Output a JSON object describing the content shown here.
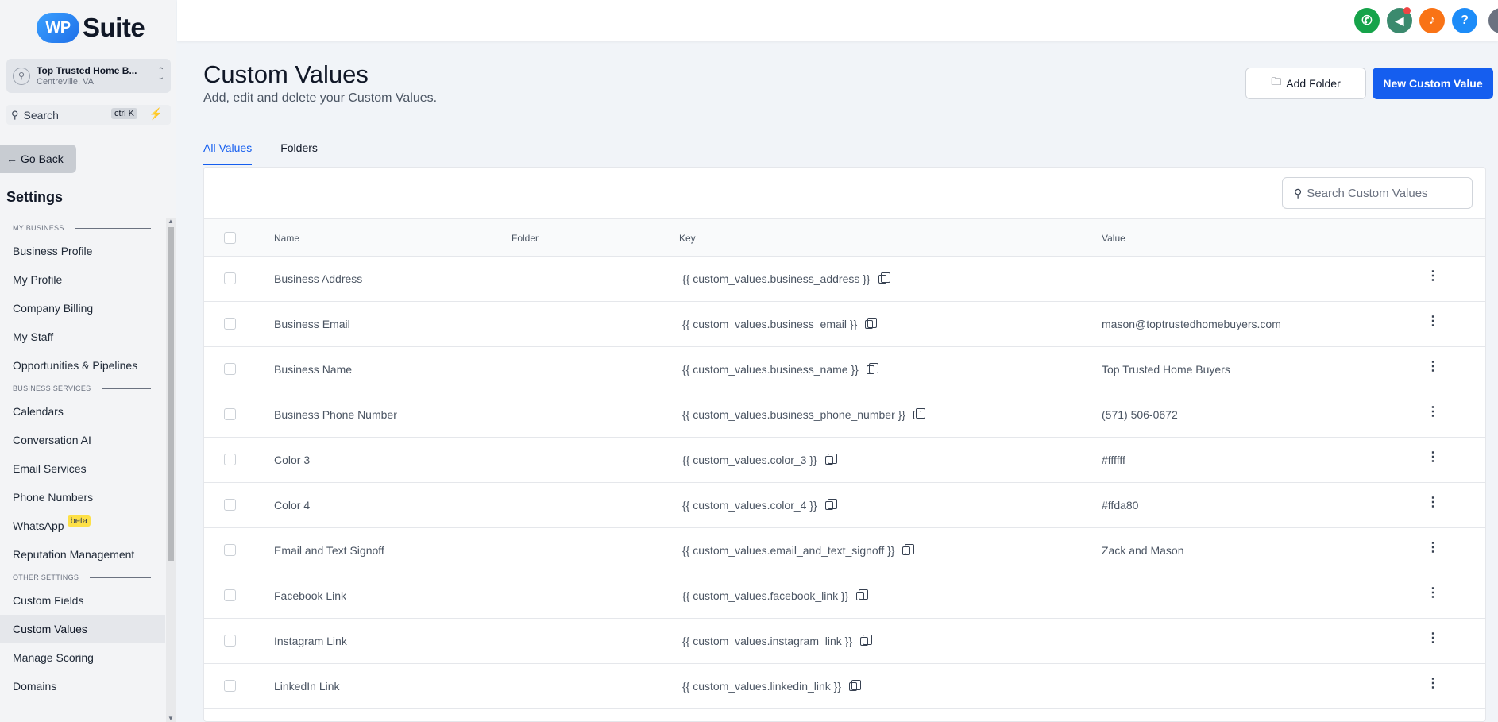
{
  "sidebar": {
    "logo": {
      "badge": "WP",
      "text": "Suite"
    },
    "account": {
      "name": "Top Trusted Home B...",
      "location": "Centreville, VA"
    },
    "search": {
      "label": "Search",
      "shortcut": "ctrl K"
    },
    "go_back": "Go Back",
    "settings_title": "Settings",
    "sections": [
      {
        "title": "MY BUSINESS",
        "items": [
          "Business Profile",
          "My Profile",
          "Company Billing",
          "My Staff",
          "Opportunities & Pipelines"
        ]
      },
      {
        "title": "BUSINESS SERVICES",
        "items": [
          "Calendars",
          "Conversation AI",
          "Email Services",
          "Phone Numbers",
          "WhatsApp",
          "Reputation Management"
        ]
      },
      {
        "title": "OTHER SETTINGS",
        "items": [
          "Custom Fields",
          "Custom Values",
          "Manage Scoring",
          "Domains"
        ]
      }
    ],
    "beta_label": "beta",
    "active_item": "Custom Values"
  },
  "topbar": {
    "icons": [
      {
        "name": "phone-icon",
        "color": "#16a34a",
        "glyph": "✆"
      },
      {
        "name": "megaphone-icon",
        "color": "#3b8a6e",
        "glyph": "📢"
      },
      {
        "name": "bell-icon",
        "color": "#f97316",
        "glyph": "🔔"
      },
      {
        "name": "help-icon",
        "color": "#1d8cf8",
        "glyph": "?"
      }
    ]
  },
  "page": {
    "title": "Custom Values",
    "subtitle": "Add, edit and delete your Custom Values.",
    "add_folder": "Add Folder",
    "new_value": "New Custom Value",
    "tabs": [
      "All Values",
      "Folders"
    ],
    "search_placeholder": "Search Custom Values"
  },
  "table": {
    "headers": {
      "name": "Name",
      "folder": "Folder",
      "key": "Key",
      "value": "Value"
    },
    "rows": [
      {
        "name": "Business Address",
        "folder": "",
        "key": "{{ custom_values.business_address }}",
        "value": ""
      },
      {
        "name": "Business Email",
        "folder": "",
        "key": "{{ custom_values.business_email }}",
        "value": "mason@toptrustedhomebuyers.com"
      },
      {
        "name": "Business Name",
        "folder": "",
        "key": "{{ custom_values.business_name }}",
        "value": "Top Trusted Home Buyers"
      },
      {
        "name": "Business Phone Number",
        "folder": "",
        "key": "{{ custom_values.business_phone_number }}",
        "value": "(571) 506-0672"
      },
      {
        "name": "Color 3",
        "folder": "",
        "key": "{{ custom_values.color_3 }}",
        "value": "#ffffff"
      },
      {
        "name": "Color 4",
        "folder": "",
        "key": "{{ custom_values.color_4 }}",
        "value": "#ffda80"
      },
      {
        "name": "Email and Text Signoff",
        "folder": "",
        "key": "{{ custom_values.email_and_text_signoff }}",
        "value": "Zack and Mason"
      },
      {
        "name": "Facebook Link",
        "folder": "",
        "key": "{{ custom_values.facebook_link }}",
        "value": ""
      },
      {
        "name": "Instagram Link",
        "folder": "",
        "key": "{{ custom_values.instagram_link }}",
        "value": ""
      },
      {
        "name": "LinkedIn Link",
        "folder": "",
        "key": "{{ custom_values.linkedin_link }}",
        "value": ""
      }
    ]
  },
  "colors": {
    "accent": "#155eef",
    "sidebar_bg": "#f3f4f6",
    "page_bg": "#f1f4f8"
  }
}
